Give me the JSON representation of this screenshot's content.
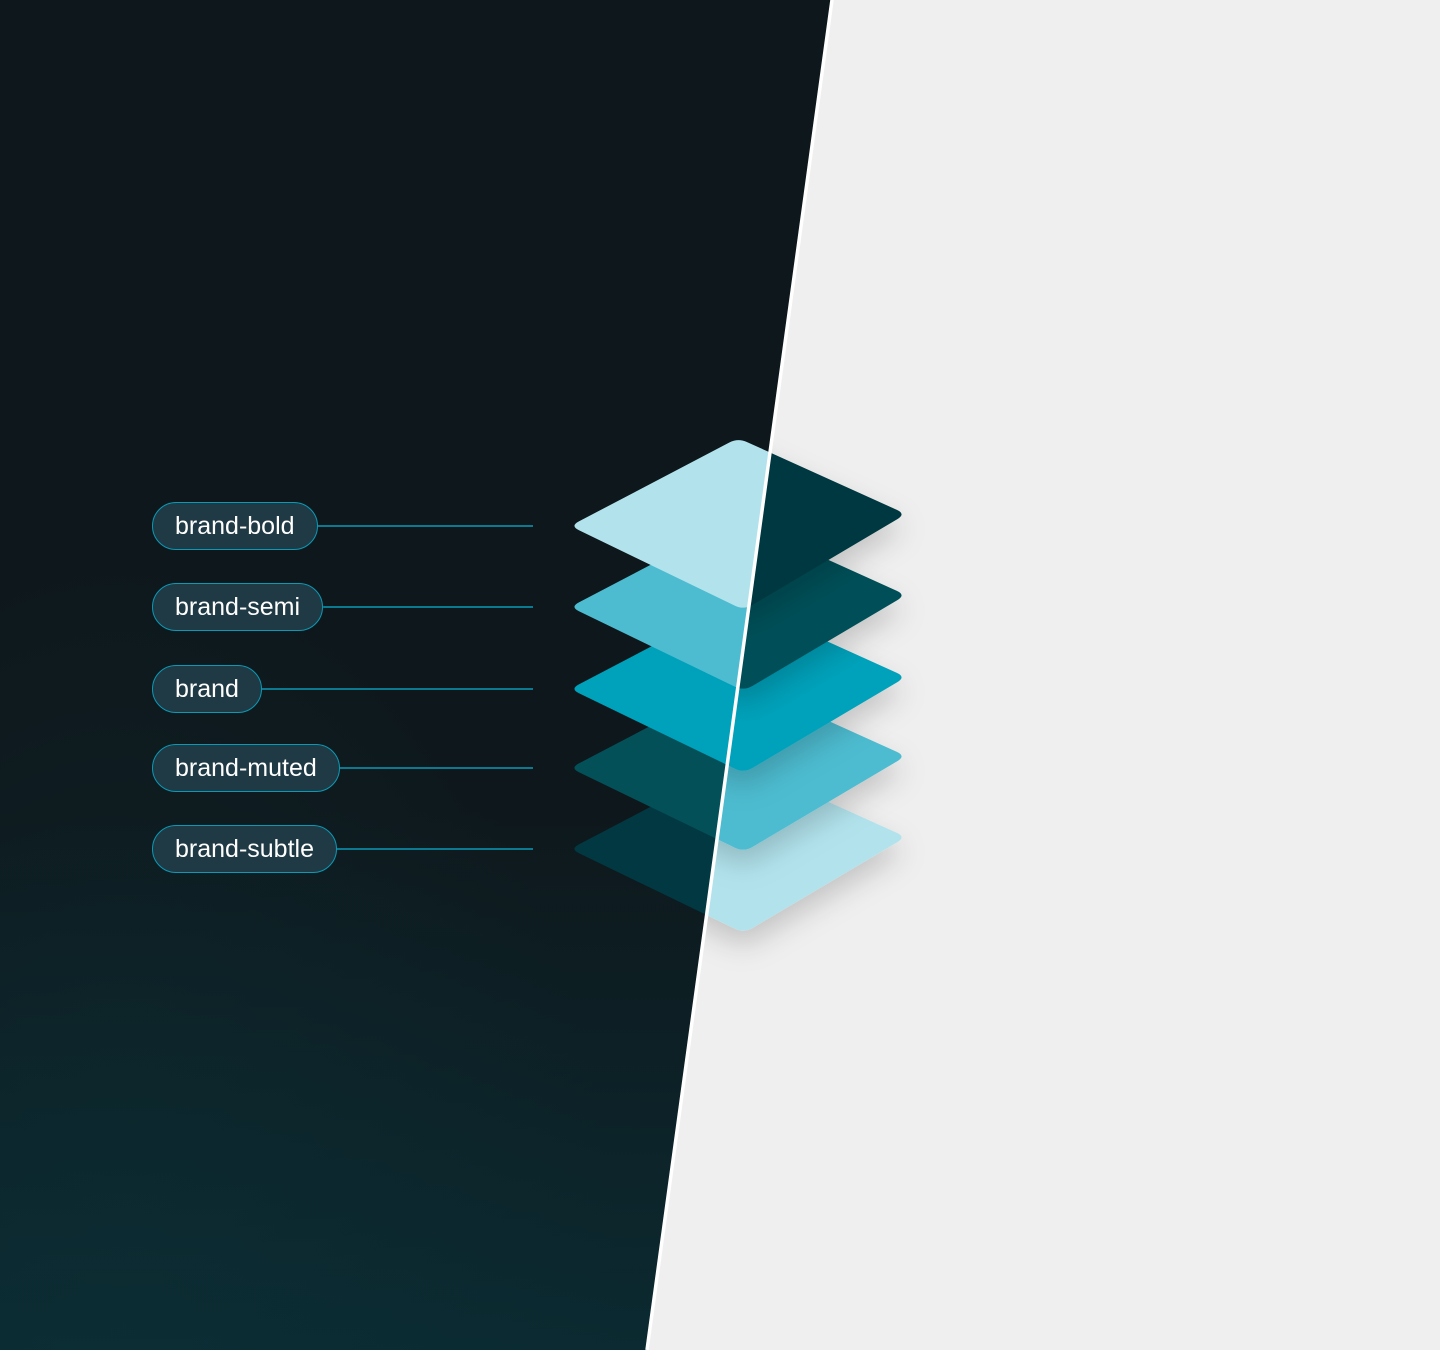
{
  "tokens": [
    {
      "label": "brand-bold"
    },
    {
      "label": "brand-semi"
    },
    {
      "label": "brand"
    },
    {
      "label": "brand-muted"
    },
    {
      "label": "brand-subtle"
    }
  ],
  "colors": {
    "dark_background_top": "#0e181c",
    "dark_background_bottom": "#0b2a31",
    "light_background": "#efefef",
    "divider": "#ffffff",
    "pill_fill": "#1f3a45",
    "pill_border": "#0a9ab6",
    "connector": "#0a9ab6",
    "layers_dark_theme": [
      "#b2e3ed",
      "#4dbcd0",
      "#00a2bb",
      "#045059",
      "#023842"
    ],
    "layers_light_theme": [
      "#023842",
      "#045059",
      "#00a2bb",
      "#4dbcd0",
      "#b2e3ed"
    ]
  }
}
